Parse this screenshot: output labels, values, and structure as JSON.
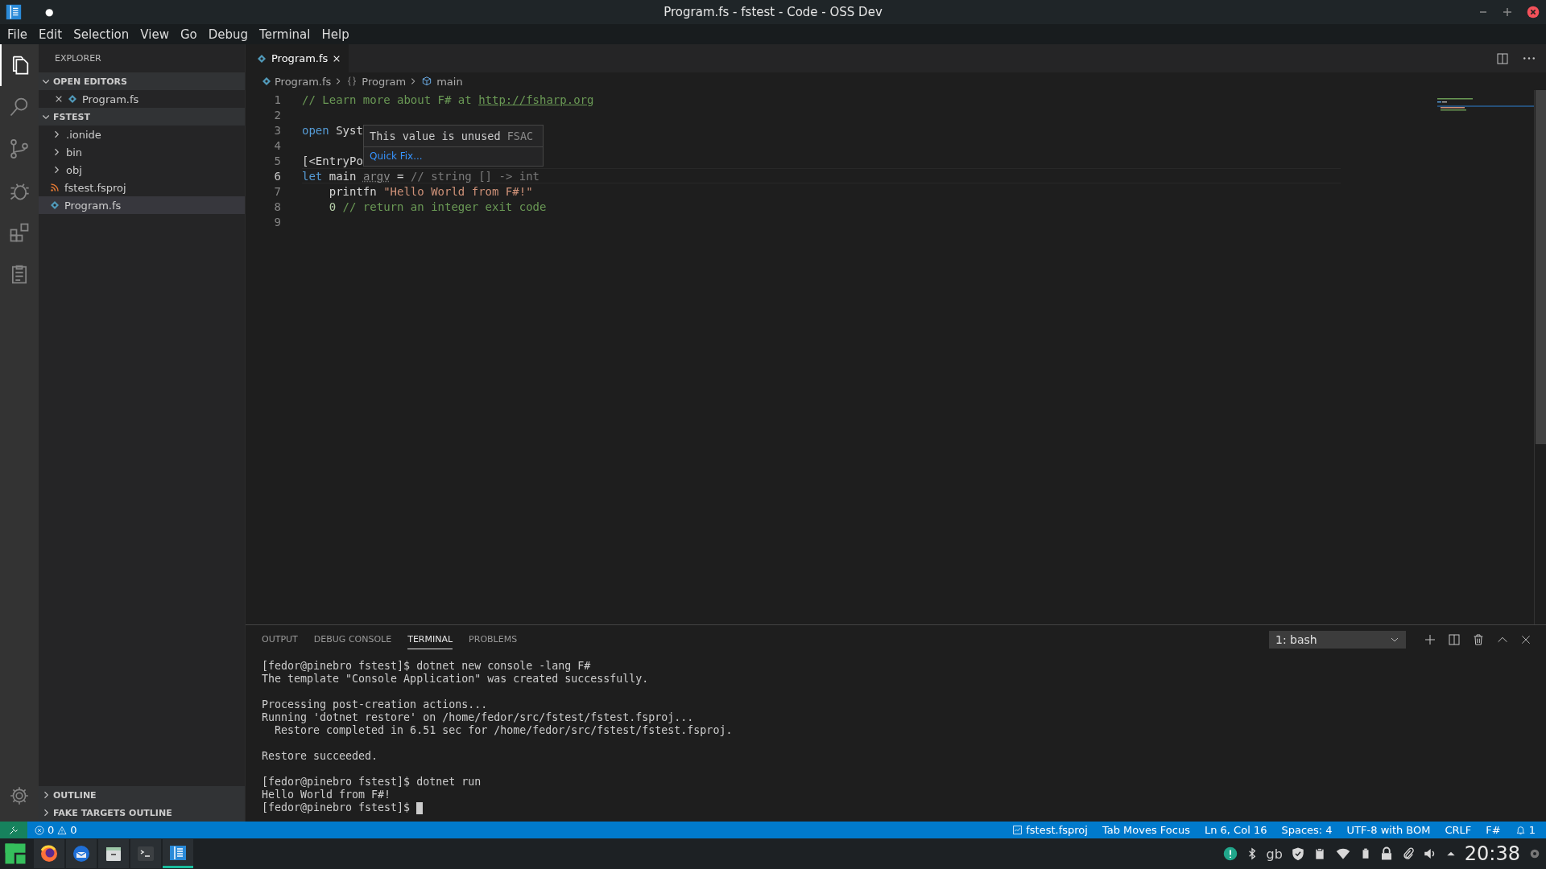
{
  "window": {
    "title": "Program.fs - fstest - Code - OSS Dev",
    "dirty_mark": "●"
  },
  "menu": [
    "File",
    "Edit",
    "Selection",
    "View",
    "Go",
    "Debug",
    "Terminal",
    "Help"
  ],
  "activity_bar": [
    {
      "kind": "files",
      "selected": true
    },
    {
      "kind": "search",
      "selected": false
    },
    {
      "kind": "scm",
      "selected": false
    },
    {
      "kind": "debug",
      "selected": false
    },
    {
      "kind": "extensions",
      "selected": false
    },
    {
      "kind": "clipboard",
      "selected": false
    }
  ],
  "sidebar": {
    "title": "EXPLORER",
    "sections": [
      {
        "title": "OPEN EDITORS",
        "expanded": true,
        "items": [
          {
            "label": "Program.fs",
            "kind": "fs",
            "selected": false,
            "closable": true
          }
        ]
      },
      {
        "title": "FSTEST",
        "expanded": true,
        "items": [
          {
            "label": ".ionide",
            "kind": "folder",
            "expanded": false,
            "selected": false
          },
          {
            "label": "bin",
            "kind": "folder",
            "expanded": false,
            "selected": false
          },
          {
            "label": "obj",
            "kind": "folder",
            "expanded": false,
            "selected": false
          },
          {
            "label": "fstest.fsproj",
            "kind": "proj",
            "selected": false
          },
          {
            "label": "Program.fs",
            "kind": "fs",
            "selected": true
          }
        ]
      }
    ],
    "bottom_sections": [
      {
        "title": "OUTLINE",
        "expanded": false
      },
      {
        "title": "FAKE TARGETS OUTLINE",
        "expanded": false
      }
    ]
  },
  "editor": {
    "tabs": [
      {
        "label": "Program.fs",
        "selected": true
      }
    ],
    "breadcrumb": [
      {
        "kind": "fs",
        "label": "Program.fs"
      },
      {
        "kind": "namespace",
        "label": "Program"
      },
      {
        "kind": "module",
        "label": "main"
      }
    ],
    "lines": [
      {
        "number": "1",
        "current": false,
        "tokens": [
          {
            "kind": "comment",
            "text": "// Learn more about F# at "
          },
          {
            "kind": "link",
            "text": "http://fsharp.org"
          }
        ]
      },
      {
        "number": "2",
        "current": false
      },
      {
        "number": "3",
        "current": false,
        "tokens": [
          {
            "kind": "keyword",
            "text": "open"
          },
          {
            "kind": "plain",
            "text": " Syst"
          }
        ]
      },
      {
        "number": "4",
        "current": false
      },
      {
        "number": "5",
        "current": false,
        "tokens": [
          {
            "kind": "plain",
            "text": "[<EntryPo"
          }
        ]
      },
      {
        "number": "6",
        "current": true,
        "tokens": [
          {
            "kind": "keyword",
            "text": "let"
          },
          {
            "kind": "plain",
            "text": " main "
          },
          {
            "kind": "unused",
            "text": "argv"
          },
          {
            "kind": "plain",
            "text": " = "
          },
          {
            "kind": "hint",
            "text": "// string [] -> int"
          }
        ]
      },
      {
        "number": "7",
        "current": false,
        "tokens": [
          {
            "kind": "plain",
            "text": "    printfn "
          },
          {
            "kind": "string",
            "text": "\"Hello World from F#!\""
          }
        ]
      },
      {
        "number": "8",
        "current": false,
        "tokens": [
          {
            "kind": "number",
            "text": "    0"
          },
          {
            "kind": "comment",
            "text": " // return an integer exit code"
          }
        ]
      },
      {
        "number": "9",
        "current": false
      }
    ],
    "hover": {
      "message": "This value is unused",
      "source": "FSAC",
      "action": "Quick Fix..."
    }
  },
  "panel": {
    "tabs": [
      {
        "label": "OUTPUT",
        "selected": false
      },
      {
        "label": "DEBUG CONSOLE",
        "selected": false
      },
      {
        "label": "TERMINAL",
        "selected": true
      },
      {
        "label": "PROBLEMS",
        "selected": false
      }
    ],
    "terminal_select": "1: bash",
    "terminal_blocks": [
      [
        "[fedor@pinebro fstest]$ dotnet new console -lang F#",
        "The template \"Console Application\" was created successfully."
      ],
      [
        "Processing post-creation actions...",
        "Running 'dotnet restore' on /home/fedor/src/fstest/fstest.fsproj...",
        "  Restore completed in 6.51 sec for /home/fedor/src/fstest/fstest.fsproj."
      ],
      [
        "Restore succeeded."
      ],
      [
        "[fedor@pinebro fstest]$ dotnet run",
        "Hello World from F#!",
        "[fedor@pinebro fstest]$ "
      ]
    ]
  },
  "status_bar": {
    "errors": "0",
    "warnings": "0",
    "right": [
      {
        "kind": "project",
        "label": "fstest.fsproj"
      },
      {
        "kind": "text",
        "label": "Tab Moves Focus"
      },
      {
        "kind": "text",
        "label": "Ln 6, Col 16"
      },
      {
        "kind": "text",
        "label": "Spaces: 4"
      },
      {
        "kind": "text",
        "label": "UTF-8 with BOM"
      },
      {
        "kind": "text",
        "label": "CRLF"
      },
      {
        "kind": "text",
        "label": "F#"
      },
      {
        "kind": "bell",
        "label": "1"
      }
    ]
  },
  "taskbar": {
    "apps": [
      {
        "kind": "firefox",
        "selected": false
      },
      {
        "kind": "mail",
        "selected": false
      },
      {
        "kind": "files",
        "selected": false
      },
      {
        "kind": "terminal",
        "selected": false
      },
      {
        "kind": "code",
        "selected": true
      }
    ],
    "tray": [
      {
        "kind": "alert"
      },
      {
        "kind": "bluetooth"
      },
      {
        "kind": "layout",
        "label": "gb"
      },
      {
        "kind": "shield"
      },
      {
        "kind": "clipboard"
      },
      {
        "kind": "wifi"
      },
      {
        "kind": "battery"
      },
      {
        "kind": "lock"
      },
      {
        "kind": "clip"
      },
      {
        "kind": "volume"
      },
      {
        "kind": "up"
      }
    ],
    "clock": "20:38"
  }
}
